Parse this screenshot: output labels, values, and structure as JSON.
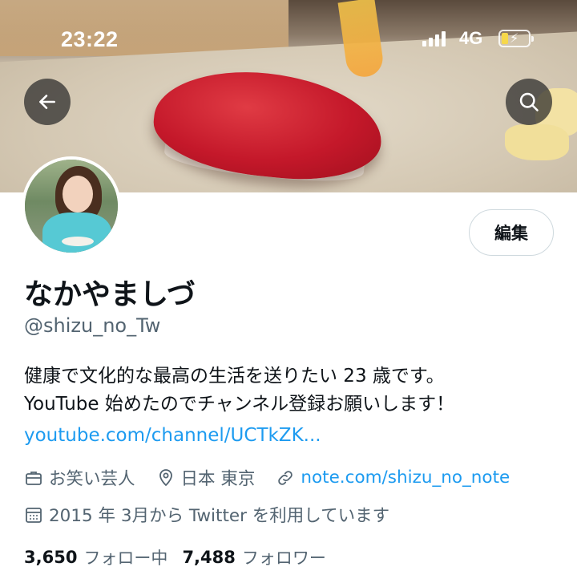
{
  "status_bar": {
    "time": "23:22",
    "network": "4G"
  },
  "header": {
    "back_icon": "arrow-left-icon",
    "search_icon": "search-icon"
  },
  "profile": {
    "edit_label": "編集",
    "display_name": "なかやましづ",
    "handle": "@shizu_no_Tw",
    "bio_line1": "健康で文化的な最高の生活を送りたい 23 歳です。",
    "bio_line2": "YouTube 始めたのでチャンネル登録お願いします！",
    "bio_link": "youtube.com/channel/UCTkZK...",
    "profession": "お笑い芸人",
    "location": "日本 東京",
    "website": "note.com/shizu_no_note",
    "joined": "2015 年 3月から Twitter を利用しています",
    "following_count": "3,650",
    "following_label": "フォロー中",
    "followers_count": "7,488",
    "followers_label": "フォロワー"
  },
  "colors": {
    "link": "#1d9bf0",
    "secondary_text": "#536471"
  }
}
